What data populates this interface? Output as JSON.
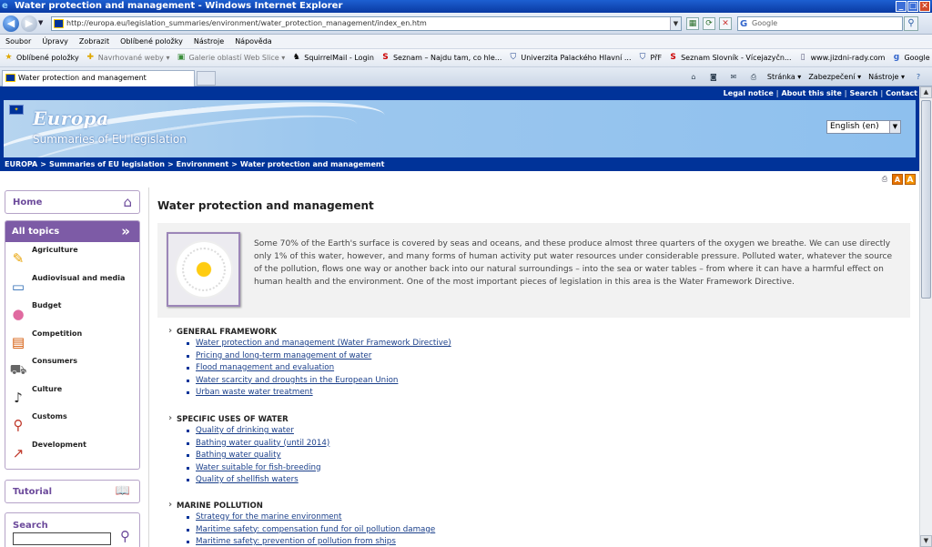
{
  "window": {
    "title": "Water protection and management - Windows Internet Explorer",
    "buttons": [
      "_",
      "□",
      "✕"
    ]
  },
  "addressbar": {
    "url": "http://europa.eu/legislation_summaries/environment/water_protection_management/index_en.htm",
    "search_placeholder": "Google"
  },
  "menubar": [
    "Soubor",
    "Úpravy",
    "Zobrazit",
    "Oblíbené položky",
    "Nástroje",
    "Nápověda"
  ],
  "favorites": [
    {
      "label": "Oblíbené položky",
      "icon": "star-icon",
      "dim": false
    },
    {
      "label": "Navrhované weby ▾",
      "icon": "add-favorite-icon",
      "dim": true
    },
    {
      "label": "Galerie oblastí Web Slice ▾",
      "icon": "web-slice-icon",
      "dim": true
    },
    {
      "label": "SquirrelMail - Login",
      "icon": "squirrel-icon",
      "dim": false
    },
    {
      "label": "Seznam – Najdu tam, co hle...",
      "icon": "seznam-icon",
      "dim": false
    },
    {
      "label": "Univerzita Palackého Hlavní ...",
      "icon": "upol-icon",
      "dim": false
    },
    {
      "label": "PřF",
      "icon": "upol-icon",
      "dim": false
    },
    {
      "label": "Seznam Slovník - Vícejazyčn...",
      "icon": "seznam-icon",
      "dim": false
    },
    {
      "label": "www.jizdni-rady.com",
      "icon": "page-icon",
      "dim": false
    },
    {
      "label": "Google",
      "icon": "google-icon",
      "dim": false
    }
  ],
  "tabbar": {
    "active_tab": "Water protection and management",
    "commands": [
      "Stránka ▾",
      "Zabezpečení ▾",
      "Nástroje ▾"
    ]
  },
  "site": {
    "toplinks": [
      "Legal notice",
      "About this site",
      "Search",
      "Contact"
    ],
    "logo": "Europa",
    "logo_sub": "Summaries of EU legislation",
    "language": "English (en)",
    "breadcrumb": [
      "EUROPA",
      "Summaries of EU legislation",
      "Environment",
      "Water protection and management"
    ],
    "nav": {
      "home": "Home",
      "all_topics": "All topics",
      "topics": [
        {
          "label": "Agriculture",
          "icon": "agriculture-icon",
          "glyph": "✎",
          "color": "#e8a200"
        },
        {
          "label": "Audiovisual and media",
          "icon": "monitor-icon",
          "glyph": "▭",
          "color": "#2f6db5"
        },
        {
          "label": "Budget",
          "icon": "piggy-bank-icon",
          "glyph": "●",
          "color": "#e06aa0"
        },
        {
          "label": "Competition",
          "icon": "stall-icon",
          "glyph": "▤",
          "color": "#d35400"
        },
        {
          "label": "Consumers",
          "icon": "cart-icon",
          "glyph": "⛟",
          "color": "#666666"
        },
        {
          "label": "Culture",
          "icon": "music-note-icon",
          "glyph": "♪",
          "color": "#333333"
        },
        {
          "label": "Customs",
          "icon": "magnifier-icon",
          "glyph": "⚲",
          "color": "#c0392b"
        },
        {
          "label": "Development",
          "icon": "chart-icon",
          "glyph": "↗",
          "color": "#c0392b"
        }
      ],
      "tutorial": "Tutorial",
      "search": "Search"
    },
    "main": {
      "title": "Water protection and management",
      "intro": "Some 70% of the Earth's surface is covered by seas and oceans, and these produce almost three quarters of the oxygen we breathe. We can use directly only 1% of this water, however, and many forms of human activity put water resources under considerable pressure. Polluted water, whatever the source of the pollution, flows one way or another back into our natural surroundings – into the sea or water tables – from where it can have a harmful effect on human health and the environment. One of the most important pieces of legislation in this area is the Water Framework Directive.",
      "sections": [
        {
          "title": "GENERAL FRAMEWORK",
          "links": [
            "Water protection and management (Water Framework Directive)",
            "Pricing and long-term management of water",
            "Flood management and evaluation",
            "Water scarcity and droughts in the European Union",
            "Urban waste water treatment"
          ]
        },
        {
          "title": "SPECIFIC USES OF WATER",
          "links": [
            "Quality of drinking water",
            "Bathing water quality (until 2014)",
            "Bathing water quality",
            "Water suitable for fish-breeding",
            "Quality of shellfish waters"
          ]
        },
        {
          "title": "MARINE POLLUTION",
          "links": [
            "Strategy for the marine environment",
            "Maritime safety: compensation fund for oil pollution damage",
            "Maritime safety: prevention of pollution from ships"
          ]
        }
      ]
    }
  }
}
